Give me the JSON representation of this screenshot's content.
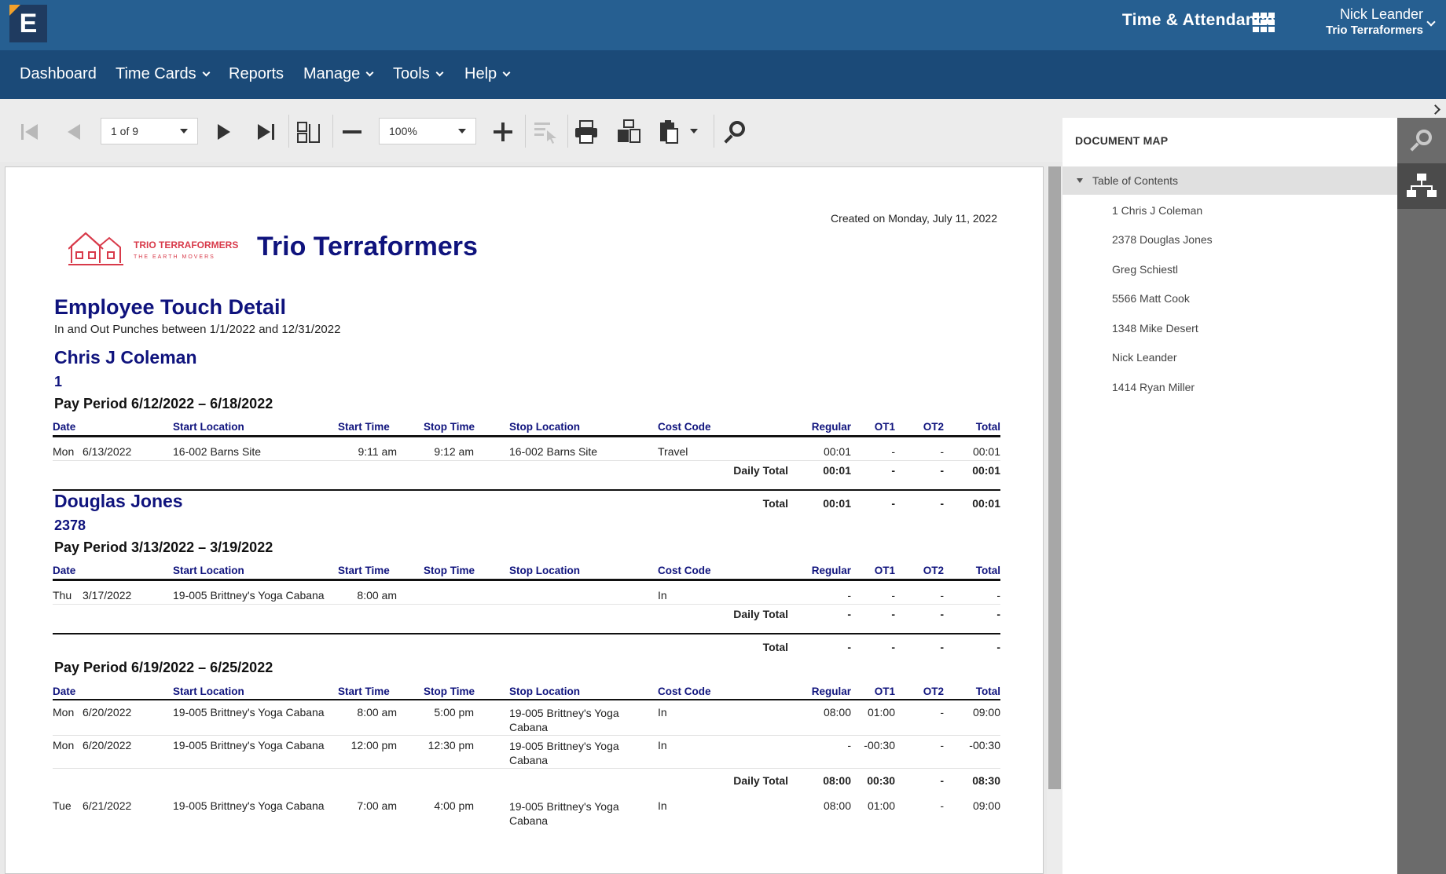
{
  "app": {
    "logo_letter": "E",
    "product_name": "Time & Attendance",
    "user_name": "Nick Leander",
    "user_org": "Trio Terraformers"
  },
  "nav": {
    "dashboard": "Dashboard",
    "time_cards": "Time Cards",
    "reports": "Reports",
    "manage": "Manage",
    "tools": "Tools",
    "help": "Help"
  },
  "toolbar": {
    "page_select": "1 of 9",
    "zoom_select": "100%",
    "icons": [
      "first-page-icon",
      "previous-page-icon",
      "next-page-icon",
      "last-page-icon",
      "page-layout-icon",
      "zoom-out-icon",
      "zoom-in-icon",
      "select-tool-icon",
      "print-icon",
      "print-preview-icon",
      "export-icon",
      "search-icon"
    ]
  },
  "report": {
    "created": "Created on Monday, July 11, 2022",
    "org_title": "Trio Terraformers",
    "logo_name": "TRIO TERRAFORMERS",
    "logo_tagline": "THE EARTH MOVERS",
    "title": "Employee Touch Detail",
    "subtitle": "In and Out Punches between 1/1/2022 and 12/31/2022",
    "columns": {
      "date": "Date",
      "start_location": "Start Location",
      "start_time": "Start Time",
      "stop_time": "Stop Time",
      "stop_location": "Stop Location",
      "cost_code": "Cost Code",
      "regular": "Regular",
      "ot1": "OT1",
      "ot2": "OT2",
      "total": "Total"
    },
    "daily_total_label": "Daily Total",
    "total_label": "Total",
    "employees": [
      {
        "name": "Chris J Coleman",
        "id": "1",
        "periods": [
          {
            "label": "Pay Period 6/12/2022 – 6/18/2022",
            "rows": [
              {
                "dow": "Mon",
                "date": "6/13/2022",
                "start_location": "16-002  Barns Site",
                "start_time": "9:11 am",
                "stop_time": "9:12 am",
                "stop_location": "16-002  Barns Site",
                "cost_code": "Travel",
                "regular": "00:01",
                "ot1": "-",
                "ot2": "-",
                "total": "00:01"
              }
            ],
            "daily_total": {
              "regular": "00:01",
              "ot1": "-",
              "ot2": "-",
              "total": "00:01"
            },
            "total": {
              "regular": "00:01",
              "ot1": "-",
              "ot2": "-",
              "total": "00:01"
            }
          }
        ]
      },
      {
        "name": "Douglas Jones",
        "id": "2378",
        "periods": [
          {
            "label": "Pay Period 3/13/2022 – 3/19/2022",
            "rows": [
              {
                "dow": "Thu",
                "date": "3/17/2022",
                "start_location": "19-005 Brittney's Yoga Cabana",
                "start_time": "8:00 am",
                "stop_time": "",
                "stop_location": "",
                "cost_code": "In",
                "regular": "-",
                "ot1": "-",
                "ot2": "-",
                "total": "-"
              }
            ],
            "daily_total": {
              "regular": "-",
              "ot1": "-",
              "ot2": "-",
              "total": "-"
            },
            "total": {
              "regular": "-",
              "ot1": "-",
              "ot2": "-",
              "total": "-"
            }
          },
          {
            "label": "Pay Period 6/19/2022 – 6/25/2022",
            "rows": [
              {
                "dow": "Mon",
                "date": "6/20/2022",
                "start_location": "19-005 Brittney's Yoga Cabana",
                "start_time": "8:00 am",
                "stop_time": "5:00 pm",
                "stop_location": "19-005 Brittney's Yoga Cabana",
                "cost_code": "In",
                "regular": "08:00",
                "ot1": "01:00",
                "ot2": "-",
                "total": "09:00"
              },
              {
                "dow": "Mon",
                "date": "6/20/2022",
                "start_location": "19-005 Brittney's Yoga Cabana",
                "start_time": "12:00 pm",
                "stop_time": "12:30 pm",
                "stop_location": "19-005 Brittney's Yoga Cabana",
                "cost_code": "In",
                "regular": "-",
                "ot1": "-00:30",
                "ot2": "-",
                "total": "-00:30"
              }
            ],
            "daily_total": {
              "regular": "08:00",
              "ot1": "00:30",
              "ot2": "-",
              "total": "08:30"
            },
            "rows_after": [
              {
                "dow": "Tue",
                "date": "6/21/2022",
                "start_location": "19-005 Brittney's Yoga Cabana",
                "start_time": "7:00 am",
                "stop_time": "4:00 pm",
                "stop_location": "19-005 Brittney's Yoga Cabana",
                "cost_code": "In",
                "regular": "08:00",
                "ot1": "01:00",
                "ot2": "-",
                "total": "09:00"
              }
            ]
          }
        ]
      }
    ]
  },
  "document_map": {
    "title": "DOCUMENT MAP",
    "root": "Table of Contents",
    "items": [
      "1 Chris J Coleman",
      "2378 Douglas Jones",
      "Greg Schiestl",
      "5566 Matt Cook",
      "1348 Mike Desert",
      "Nick Leander",
      "1414 Ryan Miller"
    ]
  },
  "colors": {
    "header_bg": "#265f91",
    "nav_bg": "#1b4a78",
    "report_title": "#0f137d",
    "logo_red": "#d83a4a"
  }
}
